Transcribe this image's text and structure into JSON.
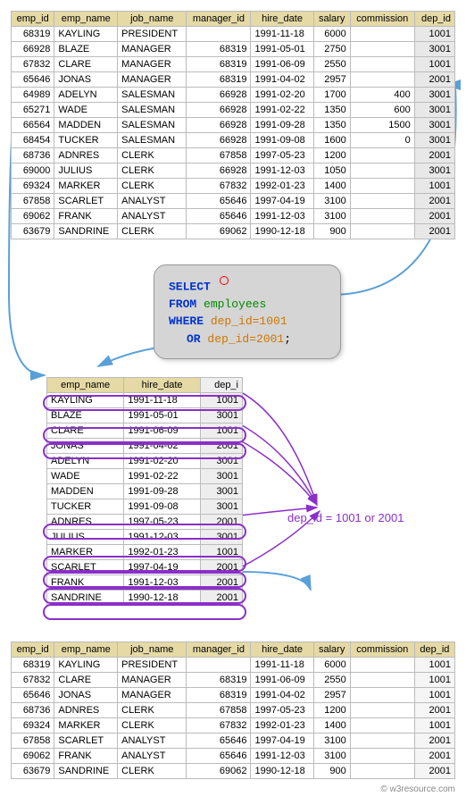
{
  "columns": [
    "emp_id",
    "emp_name",
    "job_name",
    "manager_id",
    "hire_date",
    "salary",
    "commission",
    "dep_id"
  ],
  "top_rows": [
    {
      "emp_id": "68319",
      "emp_name": "KAYLING",
      "job_name": "PRESIDENT",
      "manager_id": "",
      "hire_date": "1991-11-18",
      "salary": "6000",
      "commission": "",
      "dep_id": "1001"
    },
    {
      "emp_id": "66928",
      "emp_name": "BLAZE",
      "job_name": "MANAGER",
      "manager_id": "68319",
      "hire_date": "1991-05-01",
      "salary": "2750",
      "commission": "",
      "dep_id": "3001"
    },
    {
      "emp_id": "67832",
      "emp_name": "CLARE",
      "job_name": "MANAGER",
      "manager_id": "68319",
      "hire_date": "1991-06-09",
      "salary": "2550",
      "commission": "",
      "dep_id": "1001"
    },
    {
      "emp_id": "65646",
      "emp_name": "JONAS",
      "job_name": "MANAGER",
      "manager_id": "68319",
      "hire_date": "1991-04-02",
      "salary": "2957",
      "commission": "",
      "dep_id": "2001"
    },
    {
      "emp_id": "64989",
      "emp_name": "ADELYN",
      "job_name": "SALESMAN",
      "manager_id": "66928",
      "hire_date": "1991-02-20",
      "salary": "1700",
      "commission": "400",
      "dep_id": "3001"
    },
    {
      "emp_id": "65271",
      "emp_name": "WADE",
      "job_name": "SALESMAN",
      "manager_id": "66928",
      "hire_date": "1991-02-22",
      "salary": "1350",
      "commission": "600",
      "dep_id": "3001"
    },
    {
      "emp_id": "66564",
      "emp_name": "MADDEN",
      "job_name": "SALESMAN",
      "manager_id": "66928",
      "hire_date": "1991-09-28",
      "salary": "1350",
      "commission": "1500",
      "dep_id": "3001"
    },
    {
      "emp_id": "68454",
      "emp_name": "TUCKER",
      "job_name": "SALESMAN",
      "manager_id": "66928",
      "hire_date": "1991-09-08",
      "salary": "1600",
      "commission": "0",
      "dep_id": "3001"
    },
    {
      "emp_id": "68736",
      "emp_name": "ADNRES",
      "job_name": "CLERK",
      "manager_id": "67858",
      "hire_date": "1997-05-23",
      "salary": "1200",
      "commission": "",
      "dep_id": "2001"
    },
    {
      "emp_id": "69000",
      "emp_name": "JULIUS",
      "job_name": "CLERK",
      "manager_id": "66928",
      "hire_date": "1991-12-03",
      "salary": "1050",
      "commission": "",
      "dep_id": "3001"
    },
    {
      "emp_id": "69324",
      "emp_name": "MARKER",
      "job_name": "CLERK",
      "manager_id": "67832",
      "hire_date": "1992-01-23",
      "salary": "1400",
      "commission": "",
      "dep_id": "1001"
    },
    {
      "emp_id": "67858",
      "emp_name": "SCARLET",
      "job_name": "ANALYST",
      "manager_id": "65646",
      "hire_date": "1997-04-19",
      "salary": "3100",
      "commission": "",
      "dep_id": "2001"
    },
    {
      "emp_id": "69062",
      "emp_name": "FRANK",
      "job_name": "ANALYST",
      "manager_id": "65646",
      "hire_date": "1991-12-03",
      "salary": "3100",
      "commission": "",
      "dep_id": "2001"
    },
    {
      "emp_id": "63679",
      "emp_name": "SANDRINE",
      "job_name": "CLERK",
      "manager_id": "69062",
      "hire_date": "1990-12-18",
      "salary": "900",
      "commission": "",
      "dep_id": "2001"
    }
  ],
  "sql": {
    "select": "SELECT",
    "star": "*",
    "from": "FROM",
    "table": "employees",
    "where": "WHERE",
    "cond1": "dep_id=1001",
    "or": "OR",
    "cond2": "dep_id=2001",
    "semi": ";"
  },
  "mid_columns": [
    "emp_name",
    "hire_date",
    "dep_i"
  ],
  "mid_rows": [
    {
      "emp_name": "KAYLING",
      "hire_date": "1991-11-18",
      "dep_id": "1001",
      "hl": true
    },
    {
      "emp_name": "BLAZE",
      "hire_date": "1991-05-01",
      "dep_id": "3001",
      "hl": false
    },
    {
      "emp_name": "CLARE",
      "hire_date": "1991-06-09",
      "dep_id": "1001",
      "hl": true
    },
    {
      "emp_name": "JONAS",
      "hire_date": "1991-04-02",
      "dep_id": "2001",
      "hl": true
    },
    {
      "emp_name": "ADELYN",
      "hire_date": "1991-02-20",
      "dep_id": "3001",
      "hl": false
    },
    {
      "emp_name": "WADE",
      "hire_date": "1991-02-22",
      "dep_id": "3001",
      "hl": false
    },
    {
      "emp_name": "MADDEN",
      "hire_date": "1991-09-28",
      "dep_id": "3001",
      "hl": false
    },
    {
      "emp_name": "TUCKER",
      "hire_date": "1991-09-08",
      "dep_id": "3001",
      "hl": false
    },
    {
      "emp_name": "ADNRES",
      "hire_date": "1997-05-23",
      "dep_id": "2001",
      "hl": true
    },
    {
      "emp_name": "JULIUS",
      "hire_date": "1991-12-03",
      "dep_id": "3001",
      "hl": false
    },
    {
      "emp_name": "MARKER",
      "hire_date": "1992-01-23",
      "dep_id": "1001",
      "hl": true
    },
    {
      "emp_name": "SCARLET",
      "hire_date": "1997-04-19",
      "dep_id": "2001",
      "hl": true
    },
    {
      "emp_name": "FRANK",
      "hire_date": "1991-12-03",
      "dep_id": "2001",
      "hl": true
    },
    {
      "emp_name": "SANDRINE",
      "hire_date": "1990-12-18",
      "dep_id": "2001",
      "hl": true
    }
  ],
  "annotation": "dep_id = 1001 or 2001",
  "bottom_rows": [
    {
      "emp_id": "68319",
      "emp_name": "KAYLING",
      "job_name": "PRESIDENT",
      "manager_id": "",
      "hire_date": "1991-11-18",
      "salary": "6000",
      "commission": "",
      "dep_id": "1001"
    },
    {
      "emp_id": "67832",
      "emp_name": "CLARE",
      "job_name": "MANAGER",
      "manager_id": "68319",
      "hire_date": "1991-06-09",
      "salary": "2550",
      "commission": "",
      "dep_id": "1001"
    },
    {
      "emp_id": "65646",
      "emp_name": "JONAS",
      "job_name": "MANAGER",
      "manager_id": "68319",
      "hire_date": "1991-04-02",
      "salary": "2957",
      "commission": "",
      "dep_id": "1001"
    },
    {
      "emp_id": "68736",
      "emp_name": "ADNRES",
      "job_name": "CLERK",
      "manager_id": "67858",
      "hire_date": "1997-05-23",
      "salary": "1200",
      "commission": "",
      "dep_id": "2001"
    },
    {
      "emp_id": "69324",
      "emp_name": "MARKER",
      "job_name": "CLERK",
      "manager_id": "67832",
      "hire_date": "1992-01-23",
      "salary": "1400",
      "commission": "",
      "dep_id": "1001"
    },
    {
      "emp_id": "67858",
      "emp_name": "SCARLET",
      "job_name": "ANALYST",
      "manager_id": "65646",
      "hire_date": "1997-04-19",
      "salary": "3100",
      "commission": "",
      "dep_id": "2001"
    },
    {
      "emp_id": "69062",
      "emp_name": "FRANK",
      "job_name": "ANALYST",
      "manager_id": "65646",
      "hire_date": "1991-12-03",
      "salary": "3100",
      "commission": "",
      "dep_id": "2001"
    },
    {
      "emp_id": "63679",
      "emp_name": "SANDRINE",
      "job_name": "CLERK",
      "manager_id": "69062",
      "hire_date": "1990-12-18",
      "salary": "900",
      "commission": "",
      "dep_id": "2001"
    }
  ],
  "footer": "© w3resource.com"
}
